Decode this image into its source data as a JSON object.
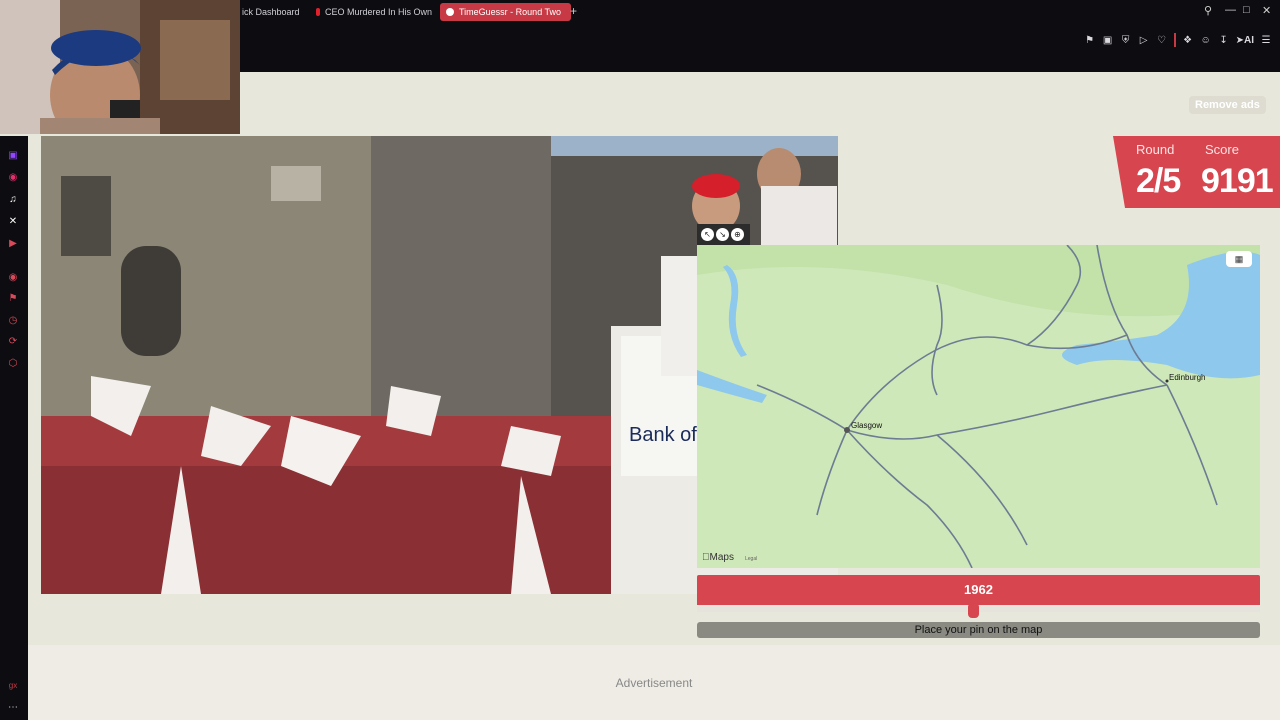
{
  "browser": {
    "tabs": [
      {
        "label": "ick Dashboard",
        "favicon_color": "#0d0d11"
      },
      {
        "label": "CEO Murdered In His Own",
        "favicon_color": "#e0202a"
      },
      {
        "label": "TimeGuessr - Round Two",
        "favicon_color": "#ffffff"
      }
    ],
    "new_tab_label": "+",
    "toolbar_icons": [
      "bookmark-icon",
      "tab-icon",
      "shield-icon",
      "play-icon",
      "heart-icon",
      "puzzle-icon",
      "profile-icon",
      "download-icon",
      "ai-icon",
      "menu-icon"
    ],
    "ai_label": "AI",
    "accent": "#c73a45"
  },
  "sidebar": {
    "icons": [
      "twitch-icon",
      "instagram-icon",
      "tiktok-icon",
      "x-icon",
      "youtube-icon",
      "record-icon",
      "pin-icon",
      "history-icon",
      "sync-icon",
      "box-icon",
      "settings-icon",
      "gx-icon",
      "more-icon"
    ]
  },
  "game": {
    "remove_ads": "Remove ads",
    "round_label": "Round",
    "round_value": "2/5",
    "score_label": "Score",
    "score_value": "9191",
    "map_labels": {
      "glasgow": "Glasgow",
      "edinburgh": "Edinburgh"
    },
    "apple_maps": "Maps",
    "legal": "Legal",
    "year": "1962",
    "year_slider_fraction": 0.492,
    "place_pin": "Place your pin on the map",
    "advertisement": "Advertisement",
    "photo_sign": "Bank of",
    "colors": {
      "accent": "#d7454f",
      "map_land": "#cfe8b9",
      "water": "#8ec8ec",
      "road": "#6d7c93"
    }
  }
}
